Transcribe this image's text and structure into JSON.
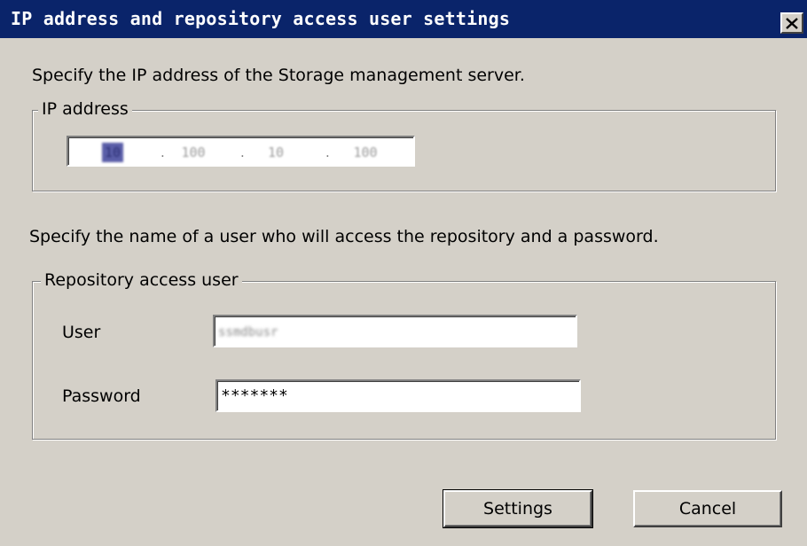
{
  "window": {
    "title": "IP address and repository access user settings",
    "close_icon": "close-icon"
  },
  "ip_section": {
    "instruction": "Specify the IP address of the Storage management server.",
    "group_label": "IP address",
    "octets": [
      "10",
      "100",
      "10",
      "100"
    ]
  },
  "user_section": {
    "instruction": "Specify the name of a user who will access the repository and a password.",
    "group_label": "Repository access user",
    "user_label": "User",
    "user_value": "ssmdbusr",
    "password_label": "Password",
    "password_value": "*******"
  },
  "buttons": {
    "settings": "Settings",
    "cancel": "Cancel"
  },
  "colors": {
    "titlebar": "#0a246a",
    "dialog_bg": "#d4d0c8"
  }
}
